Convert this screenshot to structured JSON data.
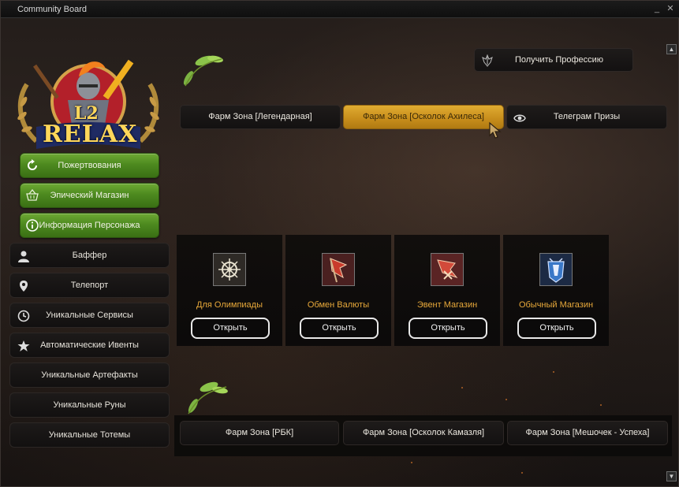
{
  "window": {
    "title": "Community Board",
    "minimize_glyph": "_",
    "close_glyph": "✕"
  },
  "logo": {
    "line1": "L2",
    "line2": "RELAX"
  },
  "green_menu": [
    {
      "label": "Пожертвования",
      "icon": "refresh-icon"
    },
    {
      "label": "Эпический Магазин",
      "icon": "basket-icon"
    },
    {
      "label": "Информация Персонажа",
      "icon": "info-icon"
    }
  ],
  "side_menu": [
    {
      "label": "Баффер",
      "icon": "user-icon"
    },
    {
      "label": "Телепорт",
      "icon": "map-pin-icon"
    },
    {
      "label": "Уникальные Сервисы",
      "icon": "clock-icon"
    },
    {
      "label": "Автоматические Ивенты",
      "icon": "star-icon"
    },
    {
      "label": "Уникальные Артефакты",
      "icon": ""
    },
    {
      "label": "Уникальные Руны",
      "icon": ""
    },
    {
      "label": "Уникальные Тотемы",
      "icon": ""
    }
  ],
  "get_profession": {
    "label": "Получить Профессию",
    "icon": "crest-icon"
  },
  "tabs": [
    {
      "label": "Фарм Зона [Легендарная]",
      "active": false
    },
    {
      "label": "Фарм Зона [Осколок Ахилеса]",
      "active": true
    },
    {
      "label": "Телеграм Призы",
      "active": false,
      "icon": "telegram-icon"
    }
  ],
  "cards": [
    {
      "label": "Для Олимпиады",
      "button": "Открыть",
      "icon": "olympiad-icon"
    },
    {
      "label": "Обмен Валюты",
      "button": "Открыть",
      "icon": "flag-icon"
    },
    {
      "label": "Эвент Магазин",
      "button": "Открыть",
      "icon": "event-flag-icon"
    },
    {
      "label": "Обычный Магазин",
      "button": "Открыть",
      "icon": "shop-crest-icon"
    }
  ],
  "bottom_buttons": [
    {
      "label": "Фарм Зона [РБК]"
    },
    {
      "label": "Фарм Зона [Осколок Камазля]"
    },
    {
      "label": "Фарм Зона [Мешочек - Успеха]"
    }
  ],
  "scroll": {
    "up": "▲",
    "down": "▼"
  },
  "colors": {
    "accent_gold": "#d9a22b",
    "green_button": "#4d8a1f",
    "card_label": "#e8a93a"
  }
}
